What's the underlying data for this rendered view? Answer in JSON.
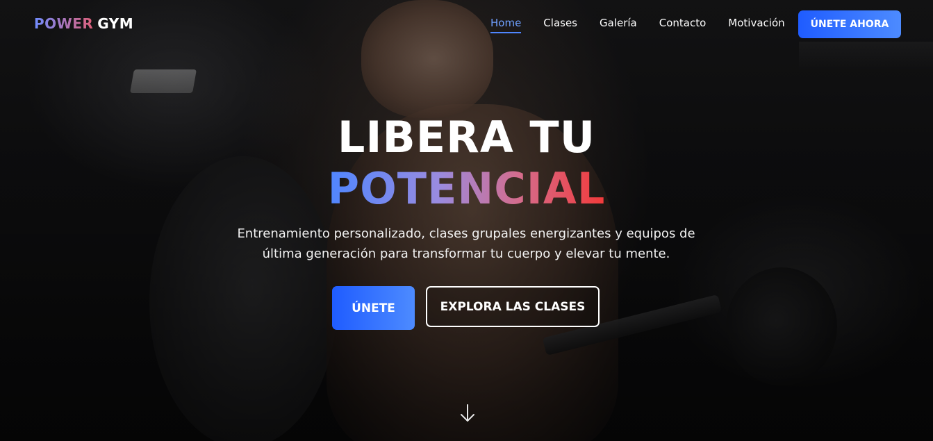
{
  "header": {
    "logo": {
      "word1": "POWER",
      "word2": "GYM"
    },
    "nav": [
      {
        "label": "Home",
        "active": true
      },
      {
        "label": "Clases",
        "active": false
      },
      {
        "label": "Galería",
        "active": false
      },
      {
        "label": "Contacto",
        "active": false
      },
      {
        "label": "Motivación",
        "active": false
      }
    ],
    "cta_label": "ÚNETE AHORA"
  },
  "hero": {
    "headline_line1": "LIBERA TU",
    "headline_line2": "POTENCIAL",
    "subtitle": "Entrenamiento personalizado, clases grupales energizantes y equipos de última generación para transformar tu cuerpo y elevar tu mente.",
    "primary_button": "ÚNETE",
    "secondary_button": "EXPLORA LAS CLASES",
    "scroll_icon": "arrow-down-icon"
  },
  "colors": {
    "accent_blue": "#1f5cff",
    "gradient_start": "#4f86ff",
    "gradient_end": "#f23a3a",
    "active_link": "#6fa0ff"
  }
}
